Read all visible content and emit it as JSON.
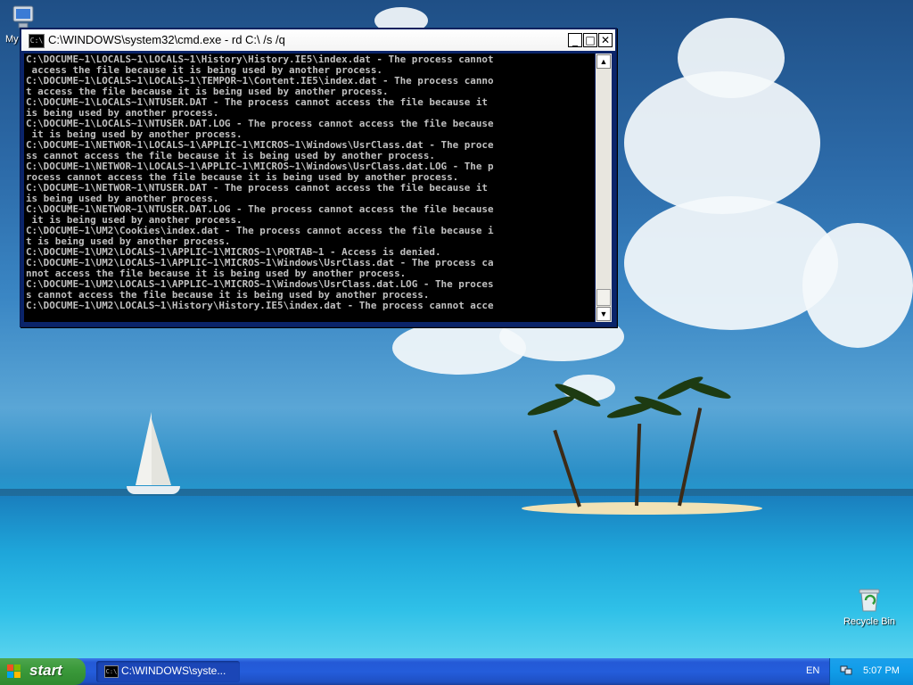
{
  "desktop": {
    "icons": [
      {
        "label": "My",
        "icon": "my-computer-icon"
      },
      {
        "label": "Recycle Bin",
        "icon": "recycle-bin-icon"
      }
    ]
  },
  "window": {
    "title": "C:\\WINDOWS\\system32\\cmd.exe - rd C:\\ /s /q",
    "icon_text": "C:\\",
    "buttons": {
      "minimize": "_",
      "maximize": "□",
      "close": "✕"
    },
    "console_lines": [
      "C:\\DOCUME~1\\LOCALS~1\\LOCALS~1\\History\\History.IE5\\index.dat - The process cannot",
      " access the file because it is being used by another process.",
      "C:\\DOCUME~1\\LOCALS~1\\LOCALS~1\\TEMPOR~1\\Content.IE5\\index.dat - The process canno",
      "t access the file because it is being used by another process.",
      "C:\\DOCUME~1\\LOCALS~1\\NTUSER.DAT - The process cannot access the file because it",
      "is being used by another process.",
      "C:\\DOCUME~1\\LOCALS~1\\NTUSER.DAT.LOG - The process cannot access the file because",
      " it is being used by another process.",
      "C:\\DOCUME~1\\NETWOR~1\\LOCALS~1\\APPLIC~1\\MICROS~1\\Windows\\UsrClass.dat - The proce",
      "ss cannot access the file because it is being used by another process.",
      "C:\\DOCUME~1\\NETWOR~1\\LOCALS~1\\APPLIC~1\\MICROS~1\\Windows\\UsrClass.dat.LOG - The p",
      "rocess cannot access the file because it is being used by another process.",
      "C:\\DOCUME~1\\NETWOR~1\\NTUSER.DAT - The process cannot access the file because it",
      "is being used by another process.",
      "C:\\DOCUME~1\\NETWOR~1\\NTUSER.DAT.LOG - The process cannot access the file because",
      " it is being used by another process.",
      "C:\\DOCUME~1\\UM2\\Cookies\\index.dat - The process cannot access the file because i",
      "t is being used by another process.",
      "C:\\DOCUME~1\\UM2\\LOCALS~1\\APPLIC~1\\MICROS~1\\PORTAB~1 - Access is denied.",
      "C:\\DOCUME~1\\UM2\\LOCALS~1\\APPLIC~1\\MICROS~1\\Windows\\UsrClass.dat - The process ca",
      "nnot access the file because it is being used by another process.",
      "C:\\DOCUME~1\\UM2\\LOCALS~1\\APPLIC~1\\MICROS~1\\Windows\\UsrClass.dat.LOG - The proces",
      "s cannot access the file because it is being used by another process.",
      "C:\\DOCUME~1\\UM2\\LOCALS~1\\History\\History.IE5\\index.dat - The process cannot acce"
    ],
    "scrollbar": {
      "up": "▲",
      "down": "▼"
    }
  },
  "taskbar": {
    "start_label": "start",
    "task_label": "C:\\WINDOWS\\syste...",
    "task_icon_text": "C:\\",
    "language": "EN",
    "clock": "5:07 PM"
  },
  "colors": {
    "title_bar": "#ffffff",
    "console_bg": "#000000",
    "console_text": "#c0c0c0",
    "taskbar": "#245ddb",
    "start_button": "#3b9a3b",
    "tray": "#109ce8"
  }
}
